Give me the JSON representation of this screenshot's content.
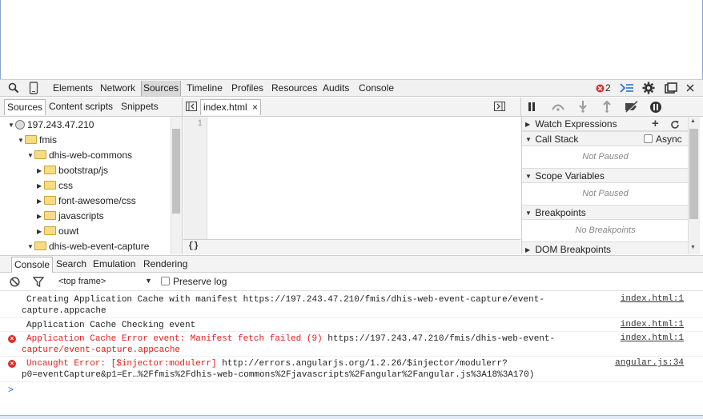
{
  "toolbar": {
    "tabs": [
      "Elements",
      "Network",
      "Sources",
      "Timeline",
      "Profiles",
      "Resources",
      "Audits",
      "Console"
    ],
    "active_tab": "Sources",
    "error_count": "2"
  },
  "navigator": {
    "tabs": [
      "Sources",
      "Content scripts",
      "Snippets"
    ],
    "active_tab": "Sources",
    "tree": {
      "host": "197.243.47.210",
      "folder_fmis": "fmis",
      "folder_commons": "dhis-web-commons",
      "children": [
        "bootstrap/js",
        "css",
        "font-awesome/css",
        "javascripts",
        "ouwt"
      ],
      "folder_event_capture": "dhis-web-event-capture"
    }
  },
  "editor": {
    "file_tab": "index.html",
    "close_glyph": "×",
    "line_numbers": [
      "1"
    ],
    "pretty_print": "{}"
  },
  "debugger": {
    "watch_expressions": "Watch Expressions",
    "call_stack": "Call Stack",
    "async_label": "Async",
    "not_paused_1": "Not Paused",
    "scope_variables": "Scope Variables",
    "not_paused_2": "Not Paused",
    "breakpoints": "Breakpoints",
    "no_breakpoints": "No Breakpoints",
    "dom_breakpoints": "DOM Breakpoints"
  },
  "drawer": {
    "tabs": [
      "Console",
      "Search",
      "Emulation",
      "Rendering"
    ],
    "active_tab": "Console",
    "frame_select": "<top frame>",
    "preserve_log": "Preserve log"
  },
  "console": {
    "messages": [
      {
        "level": "info",
        "text_line1": "Creating Application Cache with manifest ",
        "url_line1": "https://197.243.47.210/fmis/dhis-web-event-capture/event-",
        "text_line2": "capture.appcache",
        "source": "index.html:1"
      },
      {
        "level": "info",
        "text_line1": "Application Cache Checking event",
        "source": "index.html:1"
      },
      {
        "level": "error",
        "text_line1": "Application Cache Error event: Manifest fetch failed (9) ",
        "url_line1": "https://197.243.47.210/fmis/dhis-web-event-",
        "text_line2": "capture/event-capture.appcache",
        "source": "index.html:1"
      },
      {
        "level": "error",
        "text_line1": "Uncaught Error: [$injector:modulerr] ",
        "url_line1": "http://errors.angularjs.org/1.2.26/$injector/modulerr?",
        "text_line2": "p0=eventCapture&p1=Er…%2Ffmis%2Fdhis-web-commons%2Fjavascripts%2Fangular%2Fangular.js%3A18%3A170)",
        "source": "angular.js:34"
      }
    ],
    "prompt": ">"
  },
  "colors": {
    "error_red": "#e51b1b",
    "prompt_blue": "#2a70d6",
    "toolbar_bg": "#f1f1f1"
  }
}
